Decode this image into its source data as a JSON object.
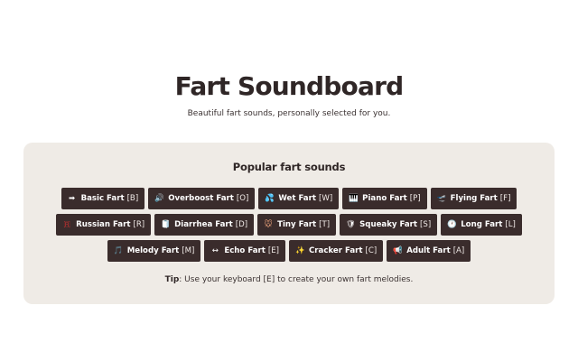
{
  "header": {
    "title": "Fart Soundboard",
    "subtitle": "Beautiful fart sounds, personally selected for you."
  },
  "card": {
    "heading": "Popular fart sounds",
    "tip_label": "Tip",
    "tip_text": ": Use your keyboard [E] to create your own fart melodies."
  },
  "buttons": [
    {
      "label": "Basic Fart",
      "key": "[B]",
      "icon": "arrow-icon",
      "glyph": "➡",
      "color": "#ffffff"
    },
    {
      "label": "Overboost Fart",
      "key": "[O]",
      "icon": "speaker-icon",
      "glyph": "🔊",
      "color": "#8ec9e8"
    },
    {
      "label": "Wet Fart",
      "key": "[W]",
      "icon": "droplets-icon",
      "glyph": "💦",
      "color": "#39b7e6"
    },
    {
      "label": "Piano Fart",
      "key": "[P]",
      "icon": "piano-icon",
      "glyph": "🎹",
      "color": "#ffffff"
    },
    {
      "label": "Flying Fart",
      "key": "[F]",
      "icon": "plane-icon",
      "glyph": "🛫",
      "color": "#d8d0c8"
    },
    {
      "label": "Russian Fart",
      "key": "[R]",
      "icon": "flag-icon",
      "glyph": "🇷",
      "color": "#d9302f"
    },
    {
      "label": "Diarrhea Fart",
      "key": "[D]",
      "icon": "paper-icon",
      "glyph": "🧻",
      "color": "#ffffff"
    },
    {
      "label": "Tiny Fart",
      "key": "[T]",
      "icon": "mouse-face-icon",
      "glyph": "🐭",
      "color": "#e8a07a"
    },
    {
      "label": "Squeaky Fart",
      "key": "[S]",
      "icon": "shield-icon",
      "glyph": "🛡",
      "color": "#ffffff"
    },
    {
      "label": "Long Fart",
      "key": "[L]",
      "icon": "clock-icon",
      "glyph": "🕐",
      "color": "#ffffff"
    },
    {
      "label": "Melody Fart",
      "key": "[M]",
      "icon": "music-icon",
      "glyph": "🎵",
      "color": "#a78bff"
    },
    {
      "label": "Echo Fart",
      "key": "[E]",
      "icon": "echo-arrows-icon",
      "glyph": "↔",
      "color": "#ffffff"
    },
    {
      "label": "Cracker Fart",
      "key": "[C]",
      "icon": "sparkles-icon",
      "glyph": "✨",
      "color": "#f5c542"
    },
    {
      "label": "Adult Fart",
      "key": "[A]",
      "icon": "megaphone-icon",
      "glyph": "📢",
      "color": "#e84a4a"
    }
  ]
}
